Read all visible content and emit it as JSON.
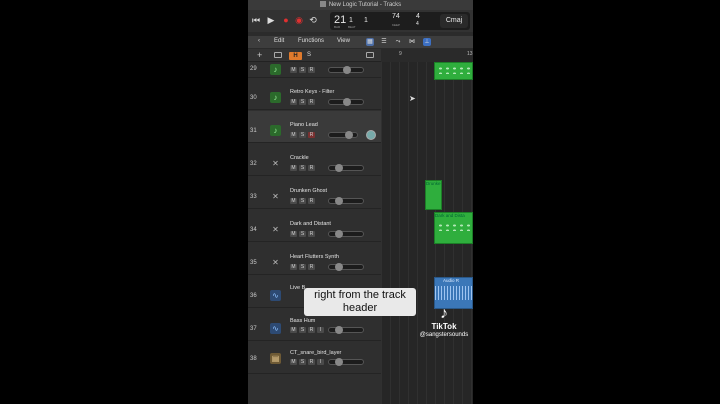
{
  "window": {
    "title": "New Logic Tutorial - Tracks"
  },
  "transport": {
    "position_bar": "21",
    "position_beat": "1",
    "position_div": "1",
    "position_sub": "1",
    "label_bar": "BAR",
    "label_beat": "BEAT",
    "tempo": "74",
    "tempo_label": "KEEP",
    "time_sig": "4",
    "time_sig_denom": "4",
    "key": "Cmaj"
  },
  "toolbar": {
    "edit": "Edit",
    "functions": "Functions",
    "view": "View"
  },
  "header": {
    "plus": "+",
    "h": "H",
    "s": "S",
    "ruler_marks": [
      "9",
      "13"
    ]
  },
  "tracks": [
    {
      "num": "29",
      "name": "",
      "icon": "instrument-icon"
    },
    {
      "num": "30",
      "name": "Retro Keys - Filter",
      "icon": "instrument-icon"
    },
    {
      "num": "31",
      "name": "Piano Lead",
      "icon": "instrument-icon"
    },
    {
      "num": "32",
      "name": "Crackle",
      "icon": "drum-icon"
    },
    {
      "num": "33",
      "name": "Drunken Ghost",
      "icon": "drum-icon"
    },
    {
      "num": "34",
      "name": "Dark and Distant",
      "icon": "drum-icon"
    },
    {
      "num": "35",
      "name": "Heart Flutters Synth",
      "icon": "drum-icon"
    },
    {
      "num": "36",
      "name": "Live B",
      "icon": "audio-icon"
    },
    {
      "num": "37",
      "name": "Bass Hum",
      "icon": "audio-icon"
    },
    {
      "num": "38",
      "name": "CT_snare_bird_layer",
      "icon": "multi-icon"
    }
  ],
  "msr": {
    "m": "M",
    "s": "S",
    "r": "R",
    "i": "I"
  },
  "regions": {
    "drunken": "Drunke",
    "dark": "Dark and Dista",
    "audio": "Audio R"
  },
  "caption": {
    "line1": "right from the track",
    "line2": "header"
  },
  "tiktok": {
    "brand": "TikTok",
    "handle": "@sangstersounds"
  },
  "colors": {
    "accent_h": "#e07a2c",
    "region_green": "#2fae3d",
    "audio_blue": "#3b77b8"
  }
}
